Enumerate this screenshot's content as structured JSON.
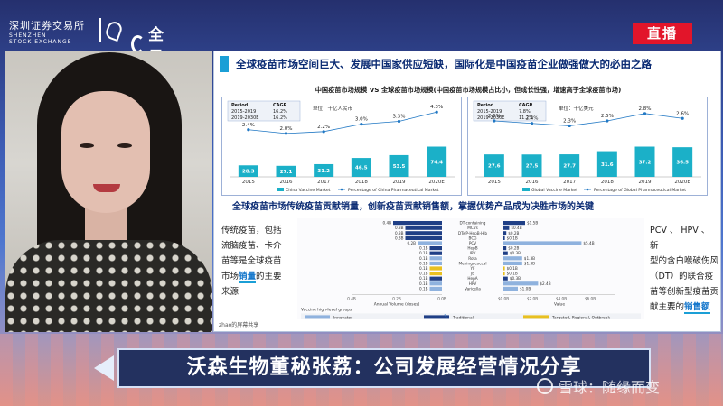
{
  "brand": {
    "sse_name": "深圳证券交易所",
    "sse_sub1": "SHENZHEN",
    "sse_sub2": "STOCK EXCHANGE",
    "quanjing": "全景"
  },
  "live_badge": "直播",
  "slide": {
    "title": "全球疫苗市场空间巨大、发展中国家供应短缺，国际化是中国疫苗企业做强做大的必由之路",
    "charts_title": "中国疫苗市场规模 VS 全球疫苗市场规模(中国疫苗市场规模占比小，但成长性强，增速高于全球疫苗市场)",
    "section2_title": "全球疫苗市场传统疫苗贡献销量，创新疫苗贡献销售额，掌握优势产品成为决胜市场的关键",
    "left_text": [
      "传统疫苗，包括",
      "流脑疫苗、卡介",
      "苗等是全球疫苗",
      "市场",
      "销量",
      "的主要",
      "来源"
    ],
    "right_text": [
      "PCV 、 HPV 、 新",
      "型的含白喉破伤风",
      "（DT）的联合疫",
      "苗等创新型疫苗贡",
      "献主要的",
      "销售额"
    ],
    "page": "3",
    "cam_label": "zhao的屏幕共享"
  },
  "chart_data": [
    {
      "type": "bar",
      "title": "",
      "unit": "单位：十亿人民币",
      "cagr_table": {
        "headers": [
          "Period",
          "CAGR"
        ],
        "rows": [
          [
            "2015-2019",
            "16.2%"
          ],
          [
            "2019-2030E",
            "16.2%"
          ]
        ]
      },
      "categories": [
        "2015",
        "2016",
        "2017",
        "2018",
        "2019",
        "2020E"
      ],
      "series": [
        {
          "name": "China Vaccine Market",
          "values": [
            28.3,
            27.1,
            31.2,
            46.5,
            53.5,
            74.4
          ],
          "color": "#1bb0c8"
        },
        {
          "name": "Percentage of China Pharmaceutical Market",
          "values": [
            2.4,
            2.0,
            2.2,
            3.0,
            3.3,
            4.3
          ],
          "labels": [
            "2.4%",
            "2.0%",
            "2.2%",
            "3.0%",
            "3.3%",
            "4.3%"
          ],
          "color": "#2178c4"
        }
      ],
      "ylim": [
        0,
        80
      ]
    },
    {
      "type": "bar",
      "title": "",
      "unit": "单位：十亿美元",
      "cagr_table": {
        "headers": [
          "Period",
          "CAGR"
        ],
        "rows": [
          [
            "2015-2019",
            "7.8%"
          ],
          [
            "2019-2030E",
            "11.2%"
          ]
        ]
      },
      "categories": [
        "2015",
        "2016",
        "2017",
        "2018",
        "2019",
        "2020E"
      ],
      "series": [
        {
          "name": "Global Vaccine Market",
          "values": [
            27.6,
            27.5,
            27.7,
            31.6,
            37.2,
            36.5
          ],
          "color": "#1bb0c8"
        },
        {
          "name": "Percentage of Global Pharmaceutical Market",
          "values": [
            2.5,
            2.4,
            2.3,
            2.5,
            2.8,
            2.6
          ],
          "labels": [
            "2.5%",
            "2.4%",
            "2.3%",
            "2.5%",
            "2.8%",
            "2.6%"
          ],
          "color": "#2178c4"
        }
      ],
      "ylim": [
        0,
        40
      ]
    },
    {
      "type": "bar",
      "title": "",
      "orientation": "butterfly",
      "categories": [
        "DT-containing",
        "MCVs",
        "DTwP-HepB-Hib",
        "BCG",
        "PCV",
        "HepB",
        "IPV",
        "Rota",
        "Meningococcal",
        "YF",
        "JE",
        "HepA",
        "HPV",
        "Varicella"
      ],
      "series": [
        {
          "name": "Annual Volume (doses)",
          "values": [
            0.4,
            0.3,
            0.3,
            0.3,
            0.2,
            0.1,
            0.1,
            0.1,
            0.1,
            0.1,
            0.1,
            0.1,
            0.1,
            0.1
          ],
          "labels": [
            "0.4B",
            "0.3B",
            "0.3B",
            "0.3B",
            "0.2B",
            "0.1B",
            "0.1B",
            "0.1B",
            "0.1B",
            "0.1B",
            "0.1B",
            "0.1B",
            "0.1B",
            "0.1B"
          ],
          "groups": [
            "traditional",
            "traditional",
            "traditional",
            "traditional",
            "innovator",
            "traditional",
            "traditional",
            "innovator",
            "innovator",
            "targeted",
            "targeted",
            "traditional",
            "innovator",
            "innovator"
          ]
        },
        {
          "name": "Value",
          "values": [
            1.5,
            0.4,
            0.2,
            0.1,
            5.4,
            0.2,
            0.3,
            1.3,
            1.3,
            0.1,
            0.1,
            0.3,
            2.4,
            1.0
          ],
          "labels": [
            "$1.5B",
            "$0.4B",
            "$0.2B",
            "$0.1B",
            "$5.4B",
            "$0.2B",
            "$0.3B",
            "$1.3B",
            "$1.3B",
            "$0.1B",
            "$0.1B",
            "$0.3B",
            "$2.4B",
            "$1.0B"
          ]
        }
      ],
      "left_axis": [
        "0.4B",
        "0.2B",
        "0.0B"
      ],
      "right_axis": [
        "$0.0B",
        "$2.0B",
        "$4.0B",
        "$6.0B"
      ],
      "xlabel_left": "Annual Volume (doses)",
      "xlabel_right": "Value",
      "legend_title": "Vaccine high-level groups",
      "legend": [
        {
          "name": "Innovator",
          "color": "#8fb2de"
        },
        {
          "name": "Traditional",
          "color": "#1f3f86"
        },
        {
          "name": "Targeted, Regional, Outbreak",
          "color": "#e8c020"
        }
      ]
    }
  ],
  "caption": "沃森生物董秘张荔：公司发展经营情况分享",
  "watermark": "雪球：随缘而变"
}
